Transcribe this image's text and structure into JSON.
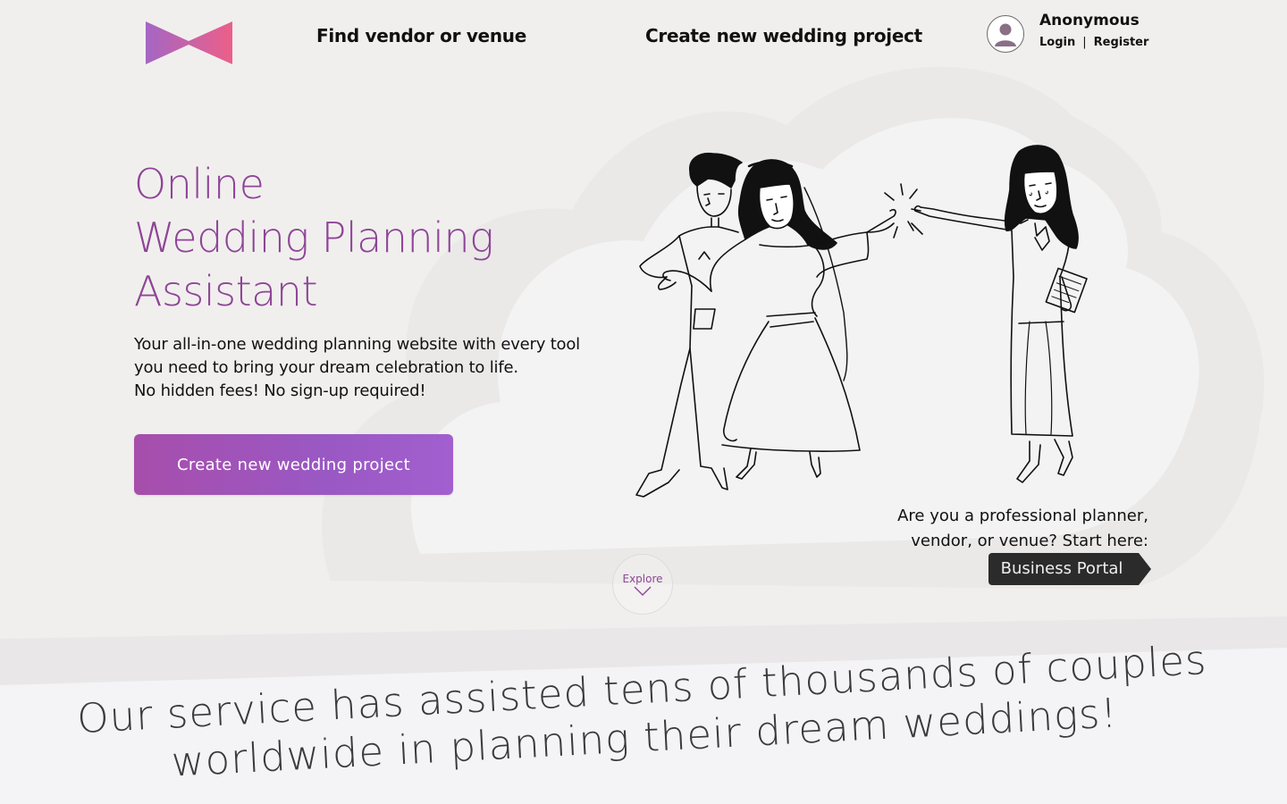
{
  "header": {
    "nav": {
      "find_vendor": "Find vendor or venue",
      "create_project": "Create new wedding project"
    },
    "user": {
      "name": "Anonymous",
      "login": "Login",
      "separator": "|",
      "register": "Register"
    }
  },
  "hero": {
    "title_lines": [
      "Online",
      "Wedding Planning",
      "Assistant"
    ],
    "description_lines": [
      "Your all-in-one wedding planning website with every tool",
      "you need to bring your dream celebration to life.",
      "No hidden fees! No sign-up required!"
    ],
    "cta_label": "Create new wedding project"
  },
  "pro": {
    "text_lines": [
      "Are you a professional planner,",
      "vendor, or venue? Start here:"
    ],
    "portal_label": "Business Portal"
  },
  "explore": {
    "label": "Explore",
    "icon": "chevron-down-icon"
  },
  "tagline_lines": [
    "Our service has assisted tens of thousands of couples",
    "worldwide in planning their dream weddings!"
  ],
  "icons": {
    "logo": "bowtie-logo",
    "avatar": "user-avatar-icon"
  },
  "colors": {
    "brand_purple": "#8e4597",
    "cta_gradient_start": "#a74eab",
    "cta_gradient_end": "#a25fcf",
    "logo_pink": "#ec5f89",
    "logo_violet": "#a466c4",
    "portal_bg": "#2b2b2b",
    "background": "#f1efee"
  }
}
